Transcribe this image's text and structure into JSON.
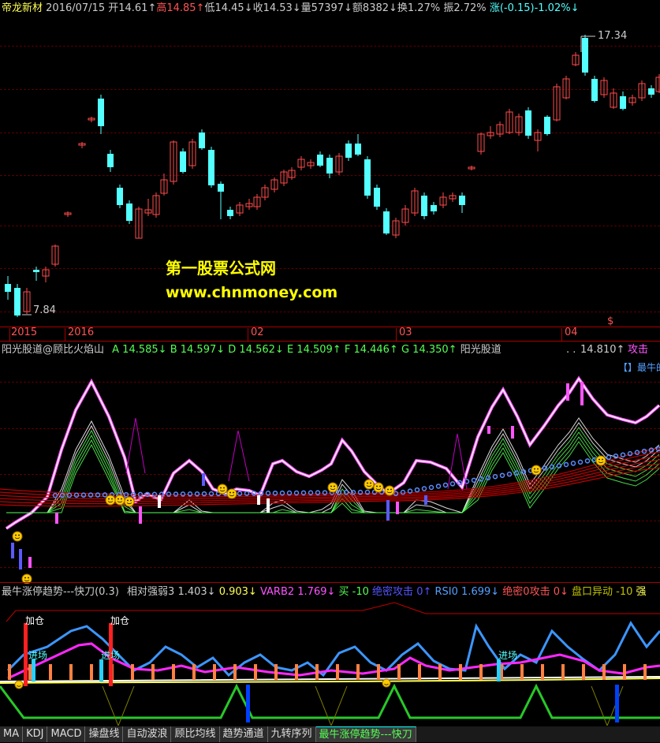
{
  "header": {
    "name": "帝龙新材",
    "date": "2016/07/15",
    "open": "开14.61↑",
    "high": "高14.85↑",
    "low": "低14.45↓",
    "close": "收14.53↓",
    "volume": "量57397↓",
    "amount": "额8382↓",
    "turnover": "换1.27%",
    "amplitude": "振2.72%",
    "change": "涨(-0.15)-1.02%↓"
  },
  "main_chart": {
    "high_label": "17.34",
    "low_label": "7.84",
    "watermark_title": "第一股票公式网",
    "watermark_url": "www.chnmoney.com",
    "time_axis": [
      "2015",
      "2016",
      "02",
      "03",
      "04"
    ],
    "time_marker": "$",
    "colors": {
      "up": "#ff4b4b",
      "down": "#54ffff",
      "bg": "#000000"
    }
  },
  "indicator1": {
    "title": "阳光股道@顾比火焰山",
    "A": "A 14.585↓",
    "B": "B 14.597↓",
    "D": "D 14.562↓",
    "E": "E 14.509↑",
    "F": "F 14.446↑",
    "G": "G 14.350↑",
    "name2": "阳光股道",
    "dots": ". .",
    "value": "14.810↑",
    "attack": "攻击",
    "legend": "【】最牛的"
  },
  "indicator2": {
    "title": "最牛涨停趋势---快刀(0.3)",
    "rs": "相对强弱3 1.403↓",
    "v2": "0.903↓",
    "varb2": "VARB2",
    "varb2_val": "1.769↓",
    "buy": "买 -10",
    "secret": "绝密攻击",
    "secret_val": "0↑",
    "rsi": "RSI0",
    "rsi_val": "1.699↓",
    "secret2": "绝密0攻击",
    "secret2_val": "0↓",
    "pankou": "盘口异动 -10",
    "strong": "强",
    "add_label_1": "加仓",
    "add_label_2": "加仓",
    "enter_label_1": "进场",
    "enter_label_2": "进场",
    "enter_label_3": "进场"
  },
  "tabs": [
    "MA",
    "KDJ",
    "MACD",
    "操盘线",
    "自动波浪",
    "顾比均线",
    "趋势通道",
    "九转序列",
    "最牛涨停趋势---快刀"
  ],
  "active_tab": 8
}
